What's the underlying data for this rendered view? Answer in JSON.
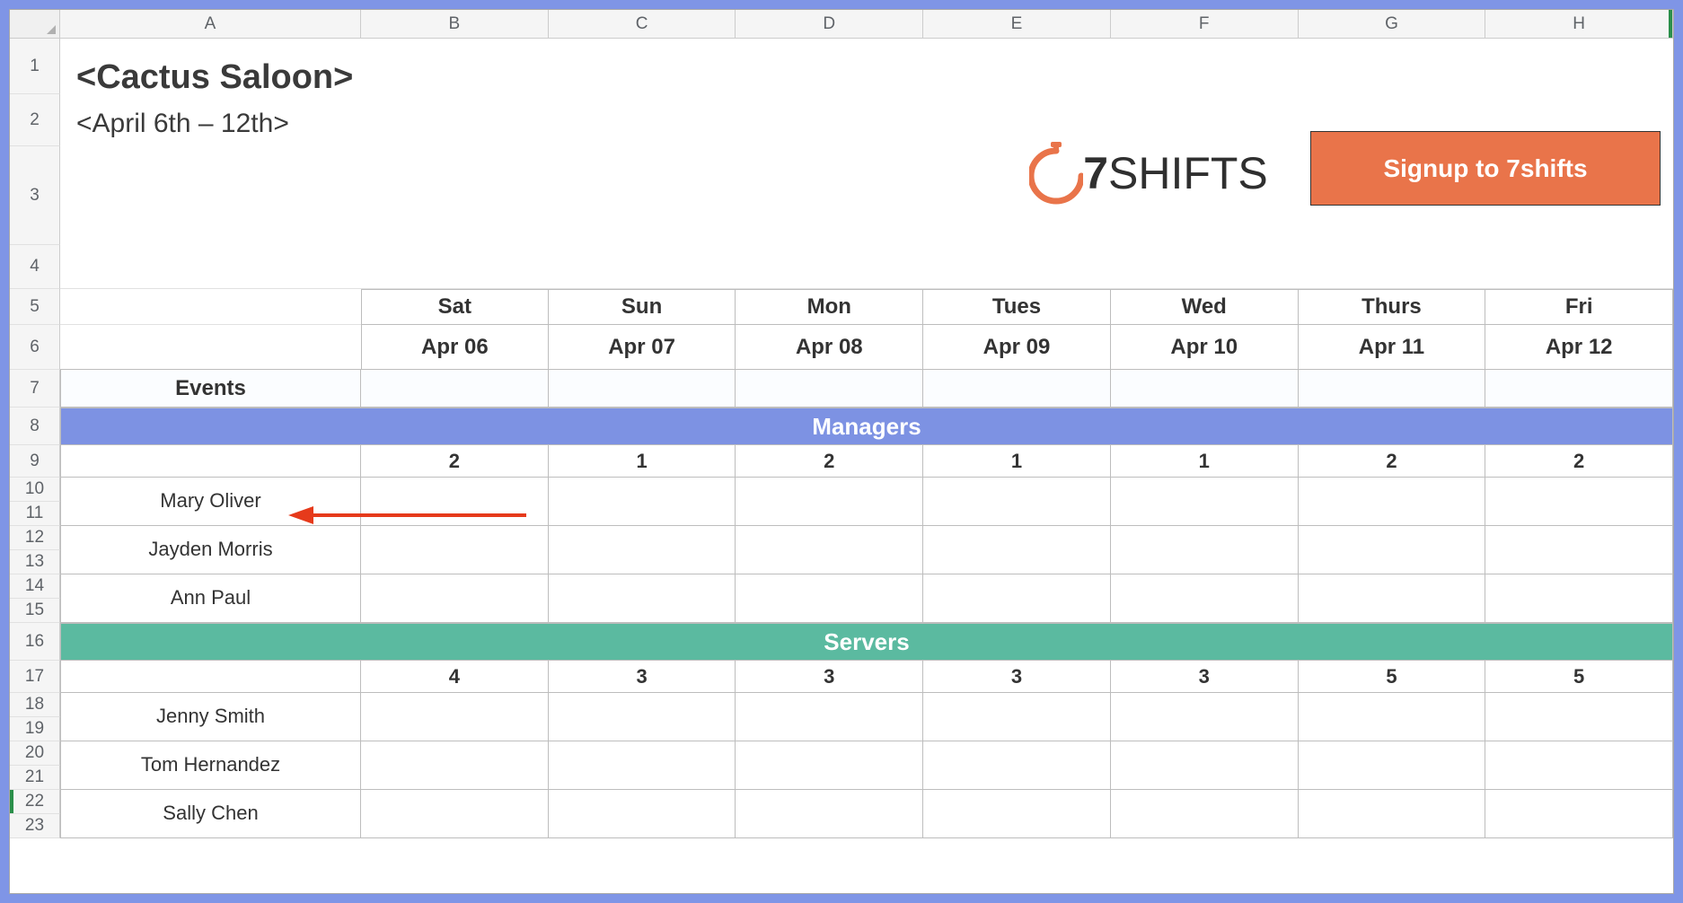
{
  "columns": [
    "A",
    "B",
    "C",
    "D",
    "E",
    "F",
    "G",
    "H"
  ],
  "row_numbers": [
    1,
    2,
    3,
    4,
    5,
    6,
    7,
    8,
    9,
    10,
    11,
    12,
    13,
    14,
    15,
    16,
    17,
    18,
    19,
    20,
    21,
    22,
    23
  ],
  "header": {
    "title": "<Cactus Saloon>",
    "subtitle": "<April 6th – 12th>",
    "logo_text_bold": "7",
    "logo_text_rest": "SHIFTS",
    "signup_label": "Signup to 7shifts"
  },
  "days": {
    "labels": [
      "Sat",
      "Sun",
      "Mon",
      "Tues",
      "Wed",
      "Thurs",
      "Fri"
    ],
    "dates": [
      "Apr 06",
      "Apr 07",
      "Apr 08",
      "Apr 09",
      "Apr 10",
      "Apr 11",
      "Apr 12"
    ]
  },
  "events_label": "Events",
  "sections": {
    "managers": {
      "title": "Managers",
      "counts": [
        "2",
        "1",
        "2",
        "1",
        "1",
        "2",
        "2"
      ],
      "people": [
        "Mary Oliver",
        "Jayden Morris",
        "Ann Paul"
      ]
    },
    "servers": {
      "title": "Servers",
      "counts": [
        "4",
        "3",
        "3",
        "3",
        "3",
        "5",
        "5"
      ],
      "people": [
        "Jenny Smith",
        "Tom Hernandez",
        "Sally Chen"
      ]
    }
  },
  "colors": {
    "frame": "#7f95e6",
    "managers_bar": "#7d92e3",
    "servers_bar": "#5bbaa0",
    "signup_btn": "#e9744a",
    "arrow": "#e63a1b"
  }
}
